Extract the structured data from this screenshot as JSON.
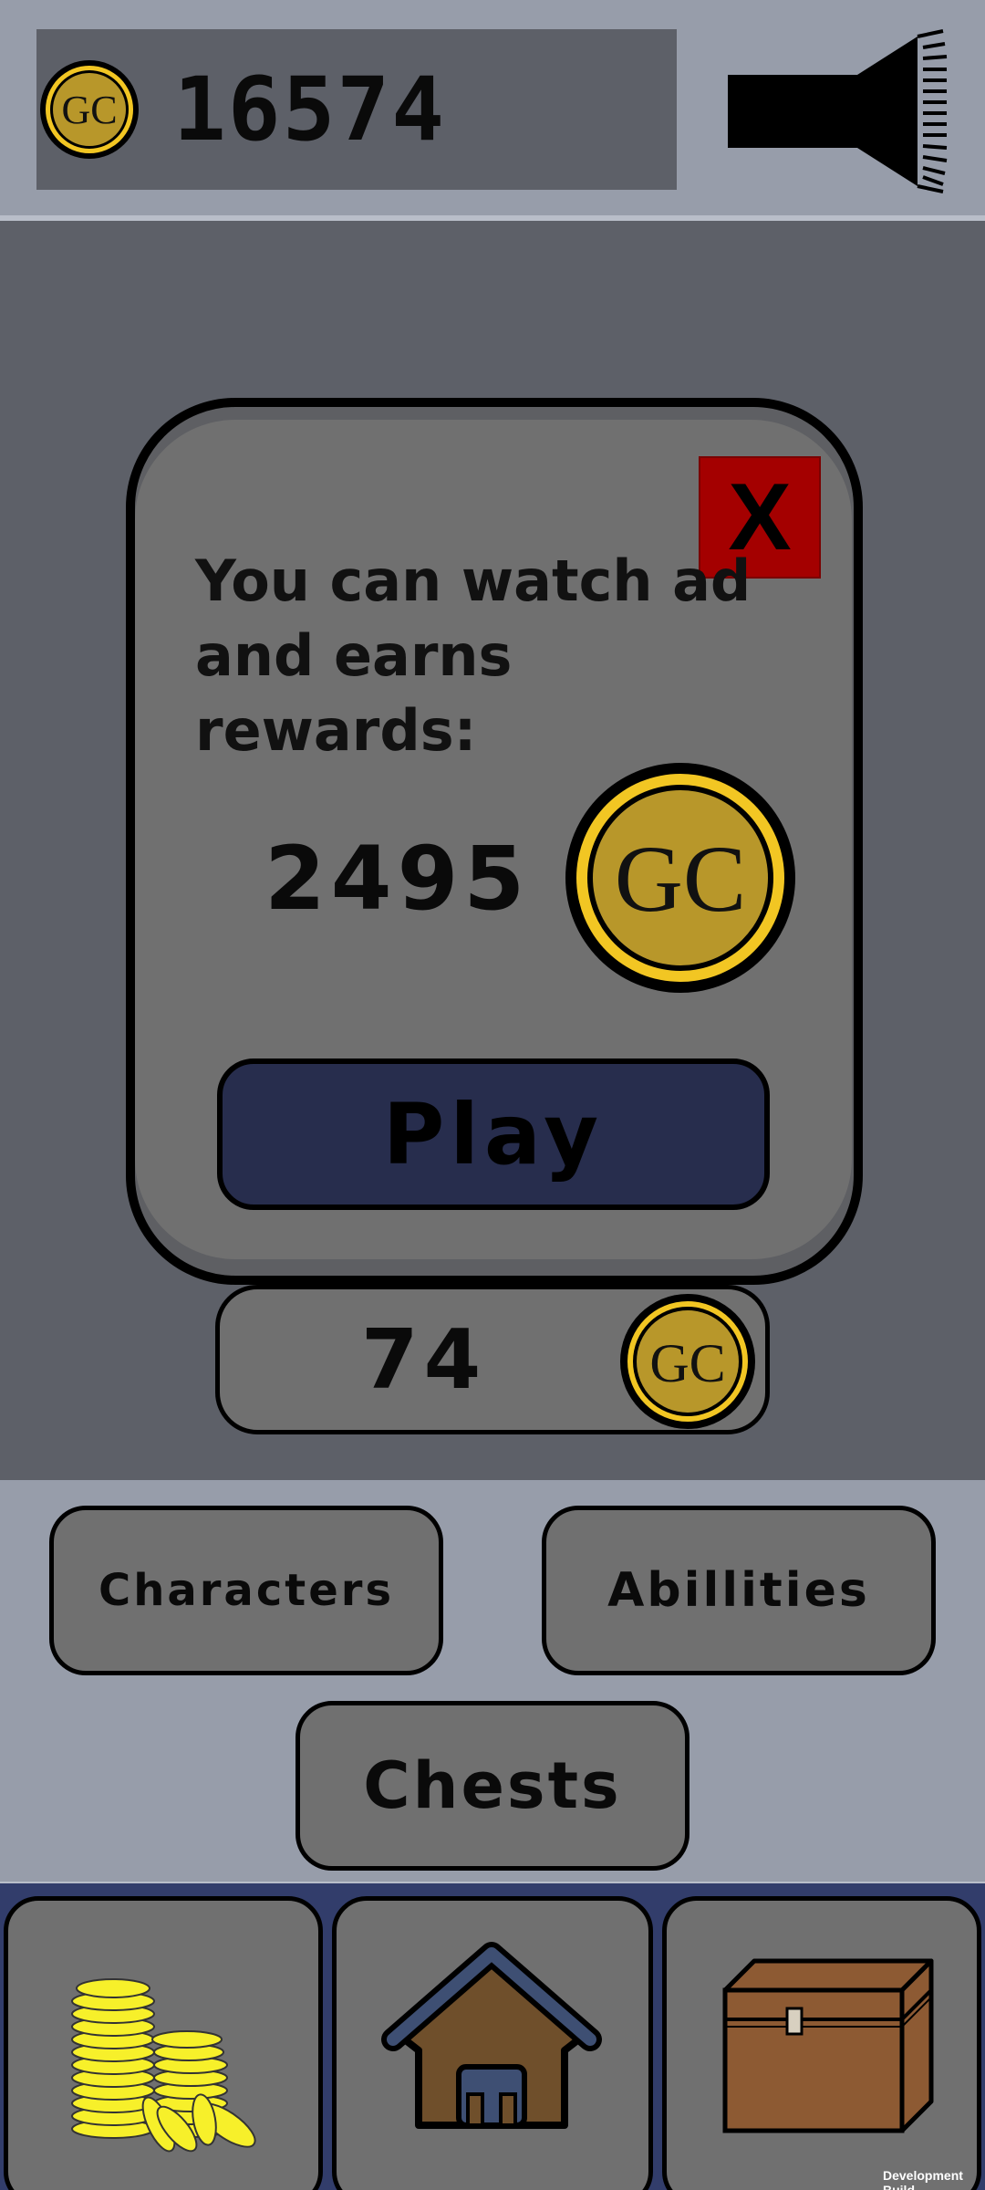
{
  "header": {
    "coin_balance": "16574",
    "coin_icon_label": "GC",
    "icon_right": "flashlight-icon"
  },
  "popup": {
    "text": "You can watch ad\nand earns rewards:",
    "close_label": "X",
    "reward_amount": "2495",
    "reward_icon_label": "GC",
    "play_label": "Play"
  },
  "mini_counter": {
    "amount": "74",
    "icon_label": "GC"
  },
  "menu": {
    "characters_label": "Characters",
    "abilities_label": "Abillities",
    "chests_label": "Chests"
  },
  "nav": {
    "tabs": [
      {
        "icon": "coin-stack-icon"
      },
      {
        "icon": "house-icon"
      },
      {
        "icon": "chest-icon"
      }
    ]
  },
  "footer": {
    "dev_build": "Development Build"
  },
  "colors": {
    "coin_gold": "#b8972a",
    "coin_ring": "#f2c623",
    "close_red": "#a40000",
    "play_navy": "#272d4d",
    "nav_bg": "#323d6b"
  }
}
